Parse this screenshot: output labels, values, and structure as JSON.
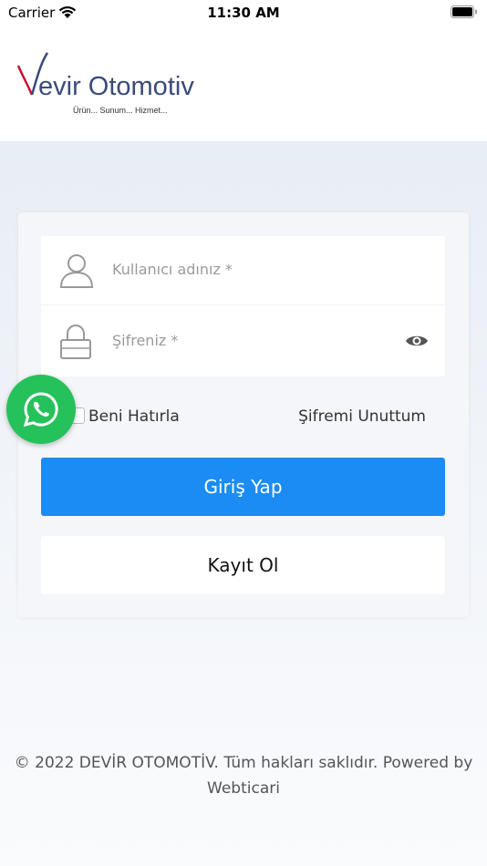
{
  "status_bar": {
    "carrier": "Carrier",
    "time": "11:30 AM"
  },
  "header": {
    "logo": {
      "brand": "Devir Otomotiv",
      "slogan": "Ürün... Sunum... Hizmet...",
      "accent_color": "#c8102e",
      "text_color": "#3a4b7a"
    }
  },
  "login_form": {
    "username_placeholder": "Kullanıcı adınız *",
    "password_placeholder": "Şifreniz *",
    "remember_label": "Beni Hatırla",
    "forgot_label": "Şifremi Unuttum",
    "login_button": "Giriş Yap",
    "register_button": "Kayıt Ol",
    "primary_color": "#1a8cf4"
  },
  "whatsapp": {
    "icon": "whatsapp-icon",
    "color": "#25c15a"
  },
  "footer": {
    "text": "© 2022 DEVİR OTOMOTİV. Tüm hakları saklıdır. Powered by Webticari"
  }
}
